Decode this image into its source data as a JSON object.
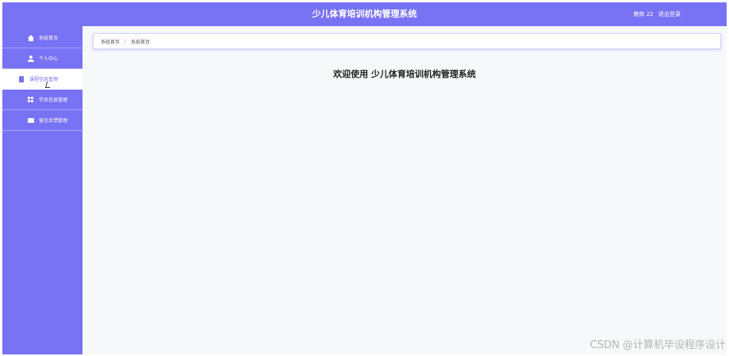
{
  "header": {
    "title": "少儿体育培训机构管理系统",
    "user_name": "教练 22",
    "logout_label": "退出登录"
  },
  "sidebar": {
    "items": [
      {
        "label": "系统首页",
        "icon": "home-icon"
      },
      {
        "label": "个人中心",
        "icon": "user-icon"
      },
      {
        "label": "课程信息管理",
        "icon": "document-icon",
        "active": true
      },
      {
        "label": "学员信息管理",
        "icon": "grid-icon"
      },
      {
        "label": "留言反馈管理",
        "icon": "message-icon"
      }
    ]
  },
  "breadcrumb": {
    "items": [
      "系统首页",
      "系统首页"
    ]
  },
  "main": {
    "welcome_text": "欢迎使用 少儿体育培训机构管理系统"
  },
  "watermark": "CSDN @计算机毕设程序设计",
  "colors": {
    "accent": "#7872f5",
    "background": "#f7f8fa",
    "text": "#222222"
  }
}
